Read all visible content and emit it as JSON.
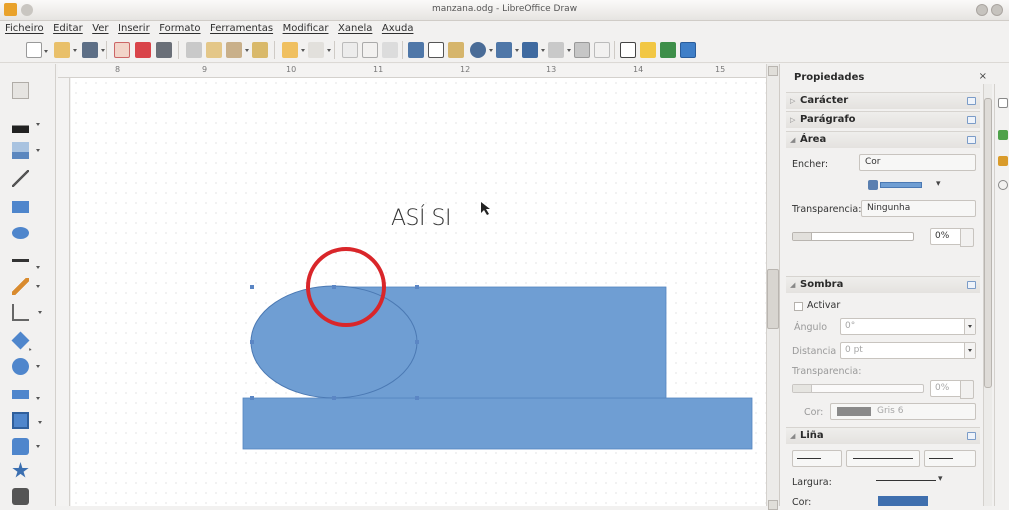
{
  "window": {
    "title": "manzana.odg - LibreOffice Draw"
  },
  "menu": [
    "Ficheiro",
    "Editar",
    "Ver",
    "Inserir",
    "Formato",
    "Ferramentas",
    "Modificar",
    "Xanela",
    "Axuda"
  ],
  "ruler": {
    "labels": [
      "8",
      "9",
      "10",
      "11",
      "12",
      "13",
      "14",
      "15"
    ]
  },
  "canvas": {
    "text": "ASÍ SI",
    "shape_color": "#6f9ed3",
    "shape_stroke": "#4b79b3",
    "highlight_color": "#d9262a"
  },
  "sidebar": {
    "title": "Propiedades",
    "close": "×",
    "sections": {
      "caracter": "Carácter",
      "paragrafo": "Parágrafo",
      "area": "Área",
      "sombra": "Sombra",
      "lina": "Liña"
    },
    "area": {
      "encher_label": "Encher:",
      "encher_value": "Cor",
      "transparencia_label": "Transparencia:",
      "transparencia_value": "Ningunha",
      "transparencia_pct": "0%"
    },
    "sombra": {
      "activar": "Activar",
      "angulo_label": "Ángulo",
      "angulo_value": "0°",
      "distancia_label": "Distancia",
      "distancia_value": "0 pt",
      "transparencia_label": "Transparencia:",
      "transparencia_pct": "0%",
      "cor_label": "Cor:",
      "cor_value": "Gris 6"
    },
    "lina": {
      "largura_label": "Largura:",
      "cor_label": "Cor:"
    }
  }
}
